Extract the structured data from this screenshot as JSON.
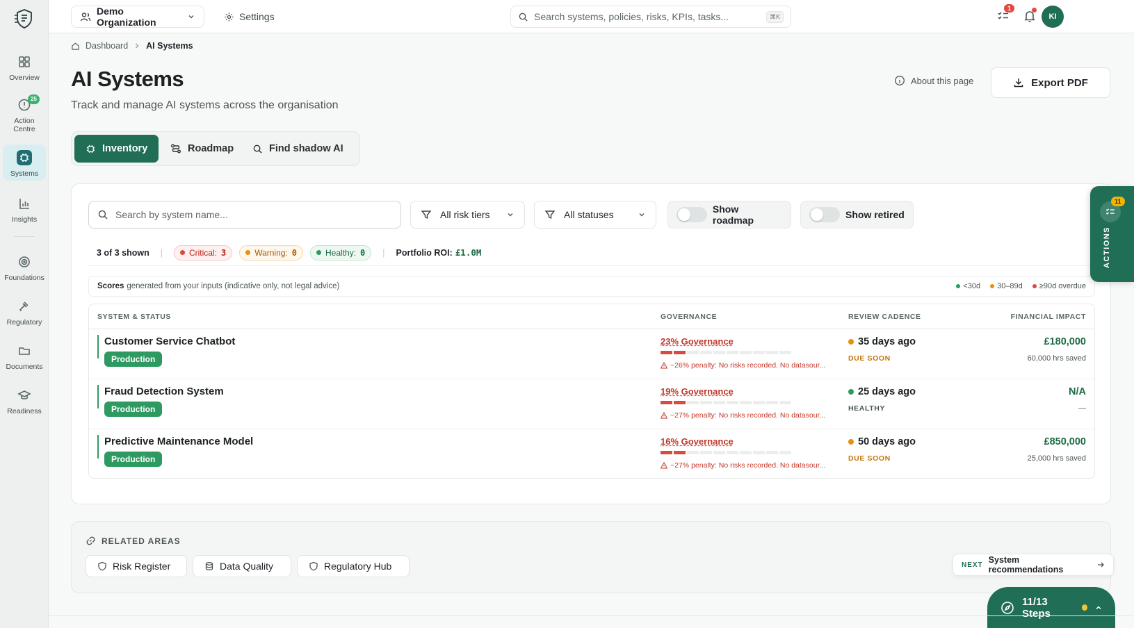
{
  "sidebar": {
    "items": [
      {
        "label": "Overview",
        "icon": "grid-icon"
      },
      {
        "label": "Action Centre",
        "icon": "alert-circle-icon",
        "badge": "25"
      },
      {
        "label": "Systems",
        "icon": "chip-icon",
        "active": true
      },
      {
        "label": "Insights",
        "icon": "bar-chart-icon"
      },
      {
        "label": "Foundations",
        "icon": "target-icon"
      },
      {
        "label": "Regulatory",
        "icon": "gavel-icon"
      },
      {
        "label": "Documents",
        "icon": "folder-icon"
      },
      {
        "label": "Readiness",
        "icon": "graduation-cap-icon"
      }
    ]
  },
  "topbar": {
    "org": "Demo Organization",
    "settings": "Settings",
    "search_placeholder": "Search systems, policies, risks, KPIs, tasks...",
    "search_kbd": "⌘K",
    "tasks_badge": "1",
    "avatar": "KI"
  },
  "breadcrumb": {
    "home": "Dashboard",
    "current": "AI Systems"
  },
  "page": {
    "title": "AI Systems",
    "subtitle": "Track and manage AI systems across the organisation",
    "about": "About this page",
    "export": "Export PDF"
  },
  "tabs": [
    {
      "label": "Inventory",
      "active": true
    },
    {
      "label": "Roadmap"
    },
    {
      "label": "Find shadow AI"
    }
  ],
  "filters": {
    "search_placeholder": "Search by system name...",
    "risk_tier": "All risk tiers",
    "status": "All statuses",
    "show_roadmap": "Show roadmap",
    "show_retired": "Show retired"
  },
  "stats": {
    "shown": "3 of 3 shown",
    "critical_label": "Critical:",
    "critical": "3",
    "warning_label": "Warning:",
    "warning": "0",
    "healthy_label": "Healthy:",
    "healthy": "0",
    "roi_label": "Portfolio ROI:",
    "roi": "£1.0M"
  },
  "scores": {
    "bold": "Scores",
    "text": "generated from your inputs (indicative only, not legal advice)",
    "legend": [
      "<30d",
      "30–89d",
      "≥90d overdue"
    ]
  },
  "table": {
    "headers": {
      "system": "SYSTEM & STATUS",
      "governance": "GOVERNANCE",
      "cadence": "REVIEW CADENCE",
      "financial": "FINANCIAL IMPACT"
    },
    "rows": [
      {
        "name": "Customer Service Chatbot",
        "status": "Production",
        "governance": "23% Governance",
        "gov_fill": 2,
        "penalty": "−26% penalty: No risks recorded. No datasour...",
        "cadence": "35 days ago",
        "cadence_status": "DUE SOON",
        "cadence_color": "#e8900c",
        "financial": "£180,000",
        "financial_sub": "60,000 hrs saved"
      },
      {
        "name": "Fraud Detection System",
        "status": "Production",
        "governance": "19% Governance",
        "gov_fill": 2,
        "penalty": "−27% penalty: No risks recorded. No datasour...",
        "cadence": "25 days ago",
        "cadence_status": "HEALTHY",
        "cadence_color": "#2e9a62",
        "financial": "N/A",
        "financial_sub": "—"
      },
      {
        "name": "Predictive Maintenance Model",
        "status": "Production",
        "governance": "16% Governance",
        "gov_fill": 2,
        "penalty": "−27% penalty: No risks recorded. No datasour...",
        "cadence": "50 days ago",
        "cadence_status": "DUE SOON",
        "cadence_color": "#e8900c",
        "financial": "£850,000",
        "financial_sub": "25,000 hrs saved"
      }
    ]
  },
  "actions_tab": {
    "label": "ACTIONS",
    "badge": "11"
  },
  "related": {
    "title": "RELATED AREAS",
    "links": [
      "Risk Register",
      "Data Quality",
      "Regulatory Hub"
    ]
  },
  "next": {
    "tag": "NEXT",
    "label": "System recommendations"
  },
  "steps": {
    "label": "11/13 Steps"
  },
  "colors": {
    "brand": "#1f6e55",
    "critical": "#d94a3f",
    "warning": "#e8900c",
    "healthy": "#2e9a62"
  }
}
